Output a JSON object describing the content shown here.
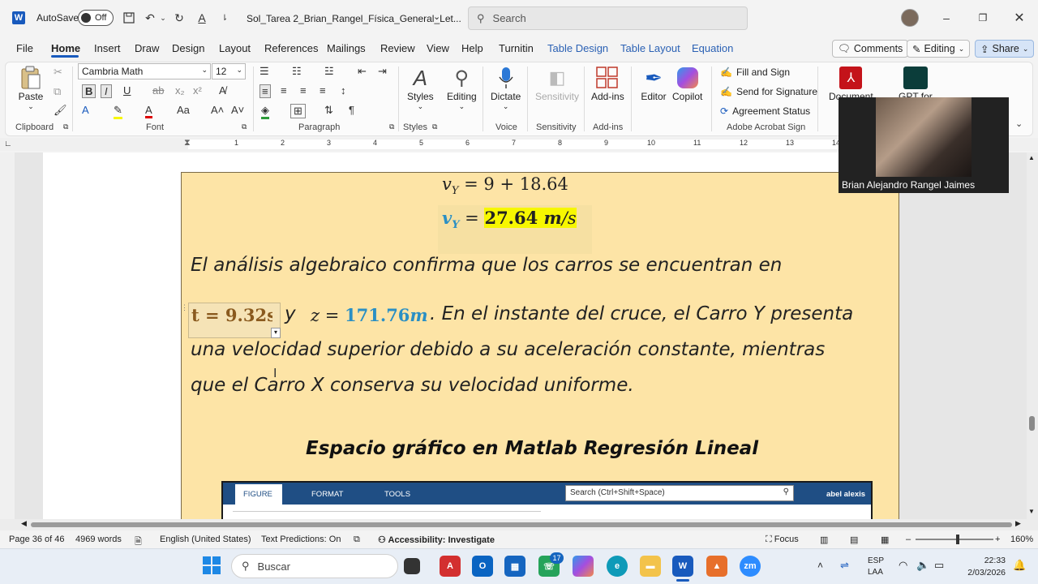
{
  "titlebar": {
    "autosave_label": "AutoSave",
    "autosave_state": "Off",
    "doc_title": "Sol_Tarea 2_Brian_Rangel_Física_General_Let...",
    "search_placeholder": "Search"
  },
  "menu": {
    "items": [
      "File",
      "Home",
      "Insert",
      "Draw",
      "Design",
      "Layout",
      "References",
      "Mailings",
      "Review",
      "View",
      "Help",
      "Turnitin"
    ],
    "context_items": [
      "Table Design",
      "Table Layout",
      "Equation"
    ],
    "comments": "Comments",
    "editing": "Editing",
    "share": "Share"
  },
  "ribbon": {
    "paste": "Paste",
    "clipboard": "Clipboard",
    "font_name": "Cambria Math",
    "font_size": "12",
    "font": "Font",
    "paragraph": "Paragraph",
    "styles_btn": "Styles",
    "styles": "Styles",
    "editing_btn": "Editing",
    "dictate": "Dictate",
    "voice": "Voice",
    "sensitivity_btn": "Sensitivity",
    "sensitivity": "Sensitivity",
    "addins_btn": "Add-ins",
    "addins": "Add-ins",
    "editor": "Editor",
    "copilot": "Copilot",
    "fill_sign": "Fill and Sign",
    "send_sign": "Send for Signature",
    "agreement": "Agreement Status",
    "acrobat": "Adobe Acrobat Sign",
    "document": "Document",
    "gpt": "GPT for"
  },
  "ruler": {
    "numbers": [
      "1",
      "2",
      "3",
      "4",
      "5",
      "6",
      "7",
      "8",
      "9",
      "10",
      "11",
      "12",
      "13",
      "14"
    ]
  },
  "document": {
    "vy_eq_lhs": "v",
    "vy_sub": "Y",
    "vy_eq_rhs": " = 9 + 18.64",
    "vy_result_value": "27.64",
    "vy_result_unit_m": "m",
    "vy_result_unit_s": "/s",
    "line1": "El análisis algebraico confirma que los carros se encuentran en",
    "t_eq": "t = 9.32s",
    "and": "y",
    "z_label": "z",
    "z_value": "171.76",
    "z_unit": "m",
    "line2_rest": ". En el instante del cruce, el Carro Y presenta",
    "line3": "una velocidad superior debido a su aceleración constante, mientras",
    "line4": "que el Carro X conserva su velocidad uniforme.",
    "heading": "Espacio gráfico en Matlab Regresión Lineal"
  },
  "matlab": {
    "tabs": [
      "FIGURE",
      "FORMAT",
      "TOOLS"
    ],
    "search": "Search (Ctrl+Shift+Space)",
    "user": "abel alexis"
  },
  "video": {
    "name": "Brian Alejandro Rangel Jaimes"
  },
  "status": {
    "page": "Page 36 of 46",
    "words": "4969 words",
    "language": "English (United States)",
    "predictions": "Text Predictions: On",
    "accessibility": "Accessibility: Investigate",
    "focus": "Focus",
    "zoom": "160%"
  },
  "taskbar": {
    "search": "Buscar",
    "whatsapp_badge": "17",
    "lang1": "ESP",
    "lang2": "LAA",
    "time": "22:33",
    "date": "2/03/2026"
  },
  "colors": {
    "accent": "#185abd",
    "frame_fill": "#fde4a6",
    "math_blue": "#2a8fc4",
    "math_gold": "#8a5a1e",
    "highlight": "#f7f700"
  }
}
